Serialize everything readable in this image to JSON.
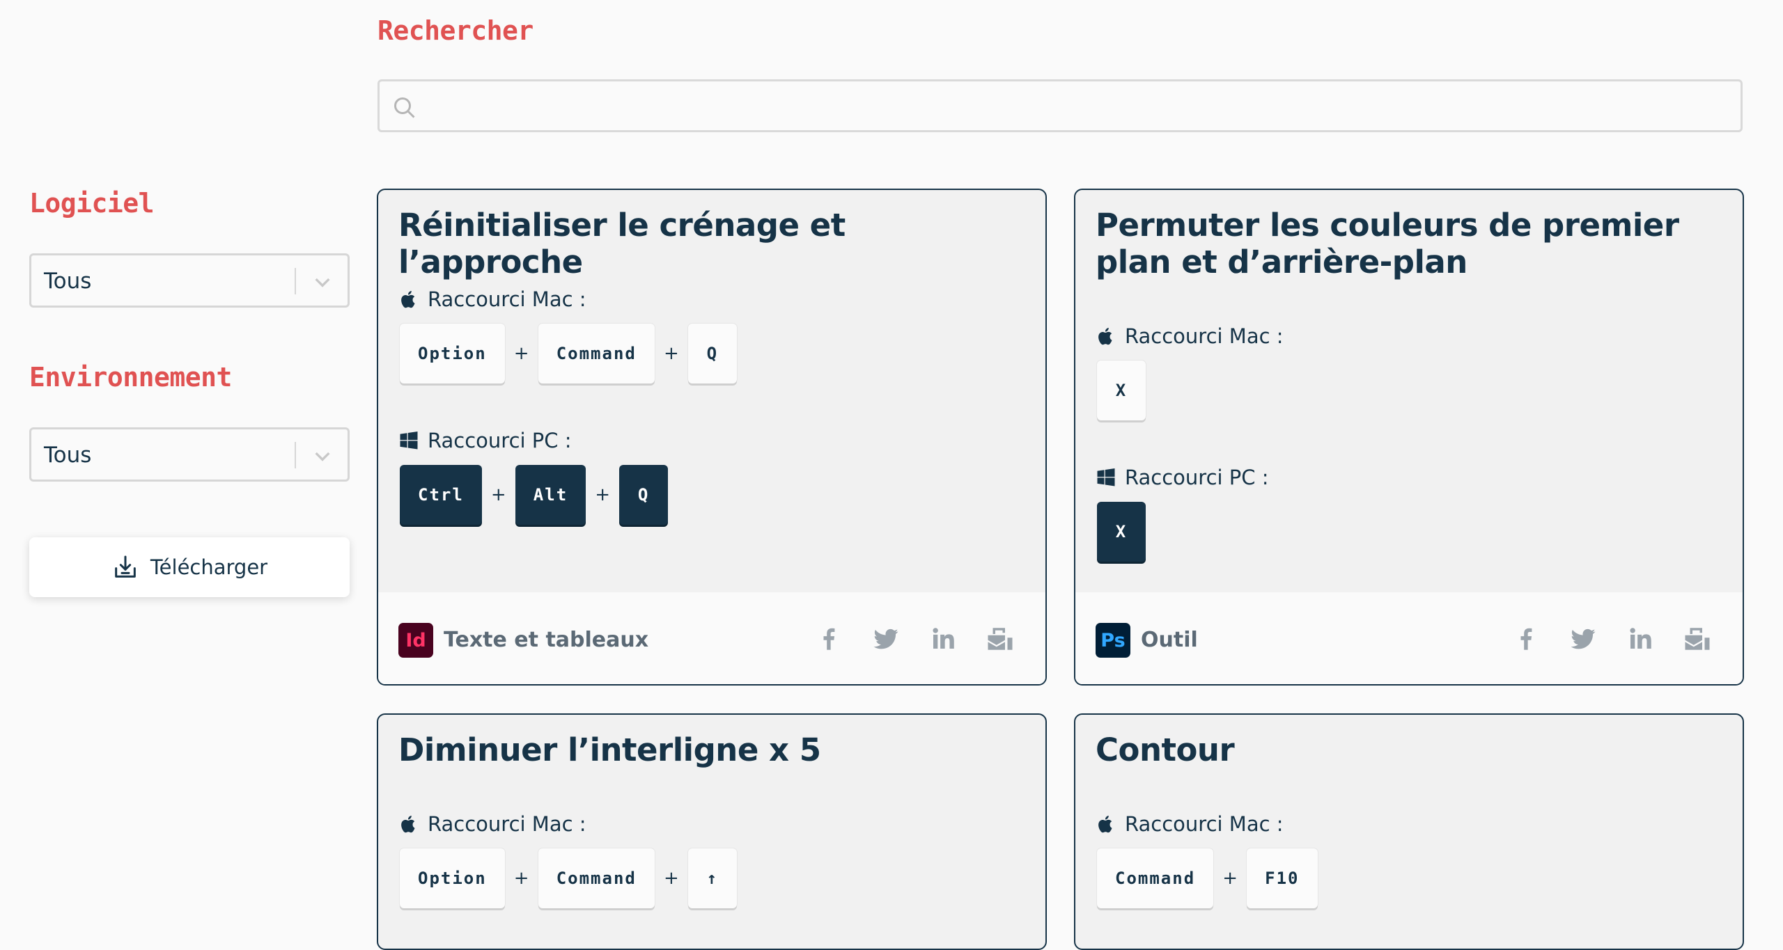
{
  "search": {
    "title": "Rechercher",
    "placeholder": ""
  },
  "filters": {
    "logiciel": {
      "title": "Logiciel",
      "value": "Tous"
    },
    "environnement": {
      "title": "Environnement",
      "value": "Tous"
    },
    "download_label": "Télécharger"
  },
  "labels": {
    "mac": "Raccourci Mac :",
    "pc": "Raccourci PC :",
    "plus": "+"
  },
  "cards": [
    {
      "title": "Réinitialiser le crénage et l’approche",
      "mac_keys": [
        "Option",
        "Command",
        "Q"
      ],
      "pc_keys": [
        "Ctrl",
        "Alt",
        "Q"
      ],
      "app": "Id",
      "category": "Texte et tableaux"
    },
    {
      "title": "Permuter les couleurs de premier plan et d’arrière-plan",
      "mac_keys": [
        "X"
      ],
      "pc_keys": [
        "X"
      ],
      "app": "Ps",
      "category": "Outil"
    },
    {
      "title": "Diminuer l’interligne x 5",
      "mac_keys": [
        "Option",
        "Command",
        "↑"
      ]
    },
    {
      "title": "Contour",
      "mac_keys": [
        "Command",
        "F10"
      ]
    }
  ],
  "colors": {
    "accent": "#e05252",
    "navy": "#163347",
    "muted": "#9aa3ab"
  },
  "icons": [
    "search-icon",
    "chevron-down-icon",
    "download-icon",
    "apple-icon",
    "windows-icon",
    "facebook-icon",
    "twitter-icon",
    "linkedin-icon",
    "share-icon"
  ]
}
